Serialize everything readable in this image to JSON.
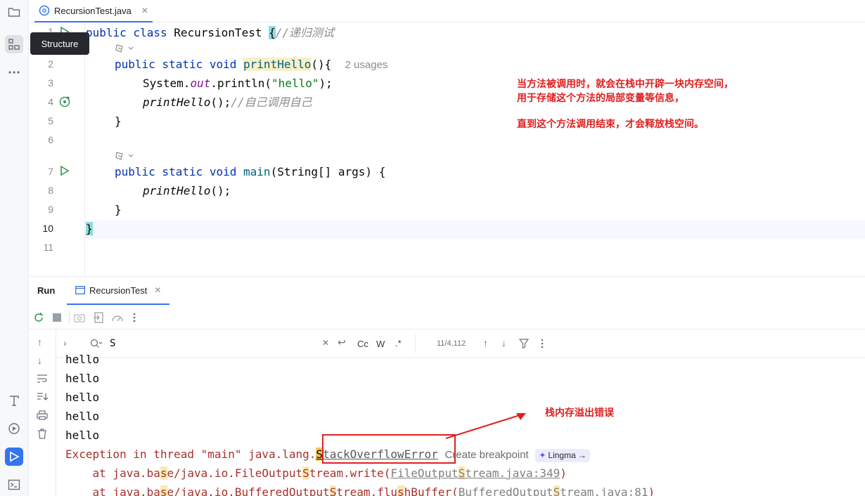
{
  "editor": {
    "tab_label": "RecursionTest.java",
    "tooltip": "Structure",
    "usages_hint": "2 usages",
    "line_numbers": [
      "1",
      "2",
      "3",
      "4",
      "5",
      "6",
      "7",
      "8",
      "9",
      "10",
      "11"
    ],
    "code": {
      "l1_kw": "public class ",
      "l1_name": "RecursionTest ",
      "l1_brace": "{",
      "l1_comment": "//递归测试",
      "l2_kw": "public static void ",
      "l2_fn": "printHello",
      "l2_rest": "(){",
      "l3_a": "System.",
      "l3_field": "out",
      "l3_b": ".println(",
      "l3_str": "\"hello\"",
      "l3_c": ");",
      "l4_call": "printHello",
      "l4_rest": "();",
      "l4_comment": "//自己调用自己",
      "l5": "}",
      "l7_kw": "public static void ",
      "l7_fn": "main",
      "l7_rest": "(String[] args) {",
      "l8_call": "printHello",
      "l8_rest": "();",
      "l9": "}",
      "l10": "}"
    }
  },
  "annotations": {
    "note1_line1": "当方法被调用时，就会在栈中开辟一块内存空间，",
    "note1_line2": "用于存储这个方法的局部变量等信息，",
    "note2": "直到这个方法调用结束，才会释放栈空间。",
    "note3": "栈内存溢出错误"
  },
  "run": {
    "title": "Run",
    "tab_label": "RecursionTest",
    "search_query": "S",
    "match_count": "11/4,112",
    "case_label": "Cc",
    "word_label": "W",
    "regex_label": ".*",
    "output_lines": [
      "hello",
      "hello",
      "hello",
      "hello",
      "hello"
    ],
    "exception_prefix": "Exception in thread \"main\" java.lang.",
    "exception_first": "S",
    "exception_rest": "tackOverflowError",
    "create_breakpoint": "Create breakpoint",
    "lingma": "Lingma",
    "trace1_a": "    at java.ba",
    "trace1_s1": "s",
    "trace1_b": "e/java.io.FileOutput",
    "trace1_s2": "S",
    "trace1_c": "tream.write(",
    "trace1_link_a": "FileOutput",
    "trace1_link_s": "S",
    "trace1_link_b": "tream.java:349",
    "trace1_d": ")",
    "trace2_a": "    at java.ba",
    "trace2_s1": "s",
    "trace2_b": "e/java.io.BufferedOutput",
    "trace2_s2": "S",
    "trace2_c": "tream.flu",
    "trace2_s3": "s",
    "trace2_d": "hBuffer(",
    "trace2_link_a": "BufferedOutput",
    "trace2_link_s": "S",
    "trace2_link_b": "tream.java:81",
    "trace2_e": ")"
  },
  "icons": {
    "strip": [
      "folder-icon",
      "structure-icon",
      "more-icon",
      "build-icon",
      "services-icon",
      "run-icon",
      "terminal-icon"
    ],
    "accent": "#3574f0",
    "annotation_color": "#e02020"
  }
}
